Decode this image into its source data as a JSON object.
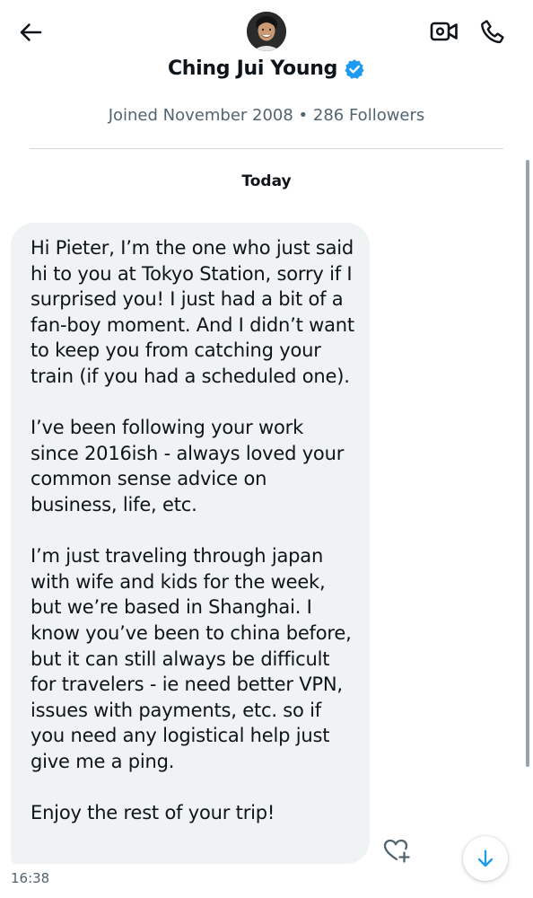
{
  "header": {
    "name": "Ching Jui Young",
    "meta": "Joined November 2008 • 286 Followers",
    "back_icon": "arrow-left-icon",
    "video_icon": "video-camera-icon",
    "call_icon": "phone-icon",
    "verified_icon": "verified-badge-icon"
  },
  "conversation": {
    "date_separator": "Today",
    "message": {
      "paragraphs": [
        "Hi Pieter, I’m the one who just said hi to you at Tokyo Station, sorry if I surprised you! I just had a bit of a fan-boy moment. And I didn’t want to keep you from catching your train (if you had a scheduled one).",
        "I’ve been following your work since 2016ish - always loved your common sense advice on business, life, etc.",
        "I’m just traveling through japan with wife and kids for the week, but we’re based in Shanghai. I know you’ve been to china before, but it can still always be difficult for travelers - ie need better VPN, issues with payments, etc. so if you need any logistical help just give me a ping.",
        "Enjoy the rest of your trip!"
      ],
      "timestamp": "16:38"
    },
    "react_icon": "heart-plus-icon",
    "scroll_down_icon": "arrow-down-icon"
  },
  "colors": {
    "text_primary": "#0f1419",
    "text_secondary": "#536471",
    "bubble_background": "#eff3f4",
    "accent_blue": "#1d9bf0",
    "divider": "#cfd9de"
  }
}
